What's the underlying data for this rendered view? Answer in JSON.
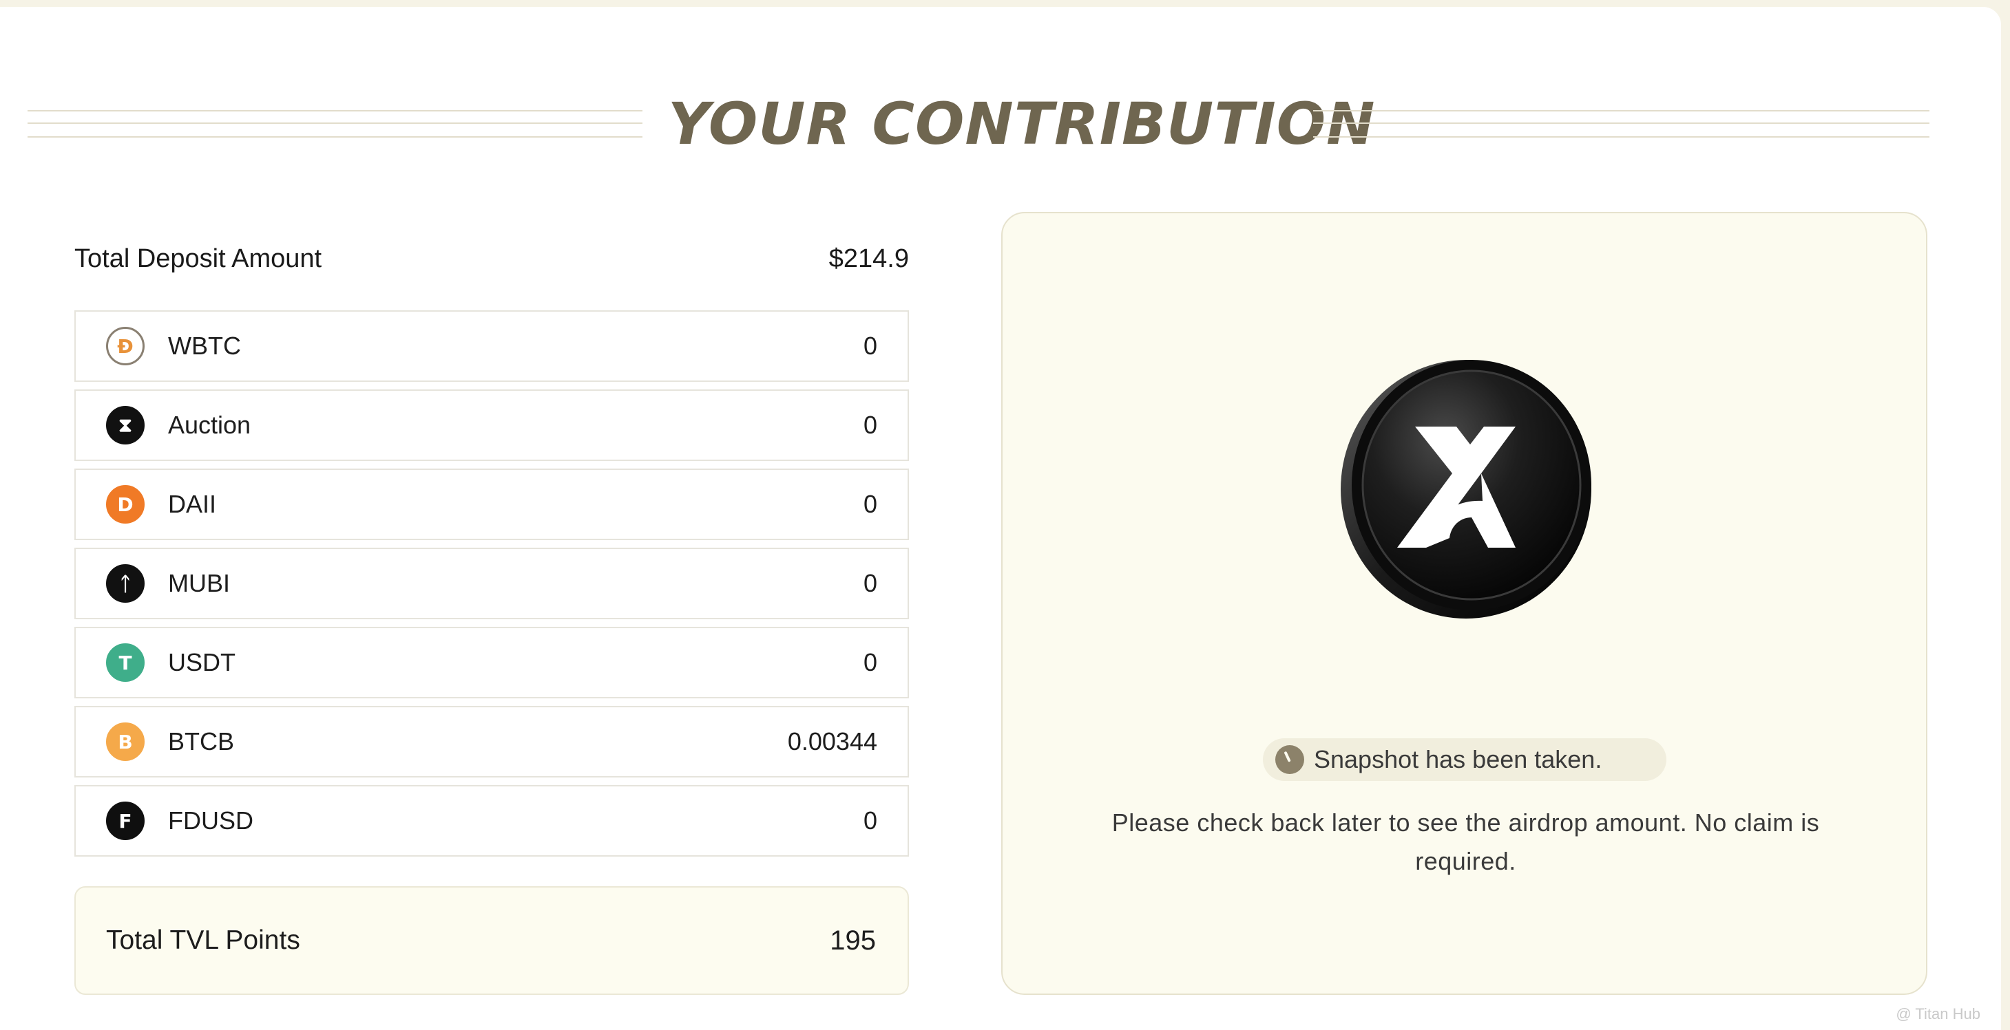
{
  "header": {
    "title": "YOUR CONTRIBUTION"
  },
  "deposit": {
    "label": "Total Deposit Amount",
    "amount": "$214.9"
  },
  "tokens": [
    {
      "symbol": "WBTC",
      "value": "0",
      "icon": "wbtc-icon",
      "icon_glyph": "Ɖ",
      "icon_bg": "#ffffff",
      "icon_fg": "#e8923a",
      "icon_border": "#8a8072"
    },
    {
      "symbol": "Auction",
      "value": "0",
      "icon": "auction-icon",
      "icon_glyph": "⧗",
      "icon_bg": "#111111",
      "icon_fg": "#ffffff",
      "icon_border": "#111111"
    },
    {
      "symbol": "DAII",
      "value": "0",
      "icon": "daii-icon",
      "icon_glyph": "D",
      "icon_bg": "#f07a26",
      "icon_fg": "#ffffff",
      "icon_border": "#f07a26"
    },
    {
      "symbol": "MUBI",
      "value": "0",
      "icon": "mubi-icon",
      "icon_glyph": "ᛏ",
      "icon_bg": "#111111",
      "icon_fg": "#ffffff",
      "icon_border": "#111111"
    },
    {
      "symbol": "USDT",
      "value": "0",
      "icon": "usdt-icon",
      "icon_glyph": "T",
      "icon_bg": "#3fae8a",
      "icon_fg": "#ffffff",
      "icon_border": "#3fae8a"
    },
    {
      "symbol": "BTCB",
      "value": "0.00344",
      "icon": "btcb-icon",
      "icon_glyph": "B",
      "icon_bg": "#f5a94a",
      "icon_fg": "#ffffff",
      "icon_border": "#f5a94a"
    },
    {
      "symbol": "FDUSD",
      "value": "0",
      "icon": "fdusd-icon",
      "icon_glyph": "F",
      "icon_bg": "#0f0f0f",
      "icon_fg": "#ffffff",
      "icon_border": "#0f0f0f"
    }
  ],
  "tvl": {
    "label": "Total TVL Points",
    "value": "195"
  },
  "airdrop": {
    "status": "Snapshot has been taken.",
    "message": "Please check back later to see the airdrop amount. No claim is required."
  },
  "watermark": "@ Titan Hub",
  "colors": {
    "title": "#6f6650",
    "panel_bg": "#fcfbef",
    "pill_bg": "#f1eedd",
    "coin": "#161616"
  }
}
